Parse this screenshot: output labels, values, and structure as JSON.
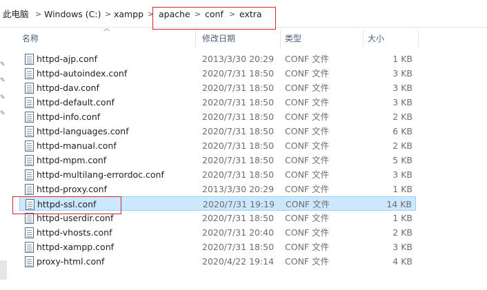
{
  "breadcrumb": {
    "items": [
      "此电脑",
      "Windows (C:)",
      "xampp",
      "apache",
      "conf",
      "extra"
    ],
    "separator": ">"
  },
  "columns": {
    "name": "名称",
    "date": "修改日期",
    "type": "类型",
    "size": "大小"
  },
  "files": [
    {
      "name": "httpd-ajp.conf",
      "date": "2013/3/30 20:29",
      "type": "CONF 文件",
      "size": "1 KB"
    },
    {
      "name": "httpd-autoindex.conf",
      "date": "2020/7/31 18:50",
      "type": "CONF 文件",
      "size": "3 KB"
    },
    {
      "name": "httpd-dav.conf",
      "date": "2020/7/31 18:50",
      "type": "CONF 文件",
      "size": "3 KB"
    },
    {
      "name": "httpd-default.conf",
      "date": "2020/7/31 18:50",
      "type": "CONF 文件",
      "size": "3 KB"
    },
    {
      "name": "httpd-info.conf",
      "date": "2020/7/31 18:50",
      "type": "CONF 文件",
      "size": "2 KB"
    },
    {
      "name": "httpd-languages.conf",
      "date": "2020/7/31 18:50",
      "type": "CONF 文件",
      "size": "6 KB"
    },
    {
      "name": "httpd-manual.conf",
      "date": "2020/7/31 18:50",
      "type": "CONF 文件",
      "size": "2 KB"
    },
    {
      "name": "httpd-mpm.conf",
      "date": "2020/7/31 18:50",
      "type": "CONF 文件",
      "size": "5 KB"
    },
    {
      "name": "httpd-multilang-errordoc.conf",
      "date": "2020/7/31 18:50",
      "type": "CONF 文件",
      "size": "3 KB"
    },
    {
      "name": "httpd-proxy.conf",
      "date": "2013/3/30 20:29",
      "type": "CONF 文件",
      "size": "1 KB"
    },
    {
      "name": "httpd-ssl.conf",
      "date": "2020/7/31 19:19",
      "type": "CONF 文件",
      "size": "14 KB"
    },
    {
      "name": "httpd-userdir.conf",
      "date": "2020/7/31 18:50",
      "type": "CONF 文件",
      "size": "1 KB"
    },
    {
      "name": "httpd-vhosts.conf",
      "date": "2020/7/31 20:40",
      "type": "CONF 文件",
      "size": "2 KB"
    },
    {
      "name": "httpd-xampp.conf",
      "date": "2020/7/31 18:50",
      "type": "CONF 文件",
      "size": "3 KB"
    },
    {
      "name": "proxy-html.conf",
      "date": "2020/4/22 19:14",
      "type": "CONF 文件",
      "size": "4 KB"
    }
  ],
  "selected_file": "httpd-ssl.conf",
  "colors": {
    "highlight_box": "#d9232e",
    "selection_bg": "#cce8ff",
    "selection_border": "#99d1ff",
    "header_text": "#4c607a"
  },
  "icons": {
    "file": "conf-file-icon",
    "pin": "pin-icon",
    "sort": "sort-up-arrow-icon",
    "separator": "chevron-right-icon"
  }
}
